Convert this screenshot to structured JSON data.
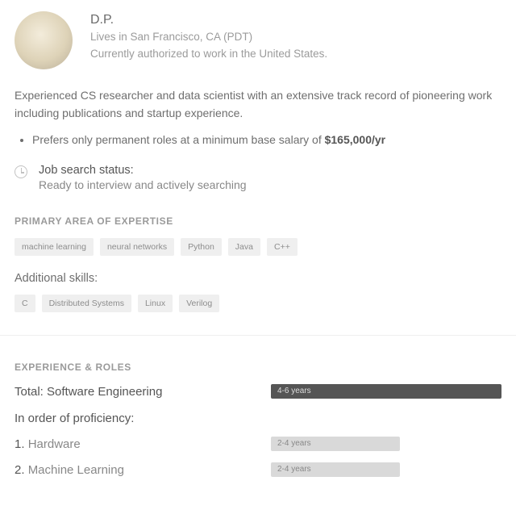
{
  "profile": {
    "name": "D.P.",
    "location_line": "Lives in San Francisco, CA (PDT)",
    "auth_line": "Currently authorized to work in the United States."
  },
  "summary": "Experienced CS researcher and data scientist with an extensive track record of pioneering work including publications and startup experience.",
  "preference": {
    "prefix": "Prefers only permanent roles at a minimum base salary of ",
    "amount": "$165,000/yr"
  },
  "status": {
    "label": "Job search status:",
    "value": "Ready to interview and actively searching"
  },
  "expertise": {
    "heading": "PRIMARY AREA OF EXPERTISE",
    "primary": [
      "machine learning",
      "neural networks",
      "Python",
      "Java",
      "C++"
    ],
    "additional_heading": "Additional skills:",
    "additional": [
      "C",
      "Distributed Systems",
      "Linux",
      "Verilog"
    ]
  },
  "experience": {
    "heading": "EXPERIENCE & ROLES",
    "total_label": "Total: Software Engineering",
    "total_years": "4-6 years",
    "total_width_pct": 100,
    "proficiency_heading": "In order of proficiency:",
    "items": [
      {
        "rank": "1.",
        "name": "Hardware",
        "years": "2-4 years",
        "width_pct": 56
      },
      {
        "rank": "2.",
        "name": "Machine Learning",
        "years": "2-4 years",
        "width_pct": 56
      }
    ]
  }
}
